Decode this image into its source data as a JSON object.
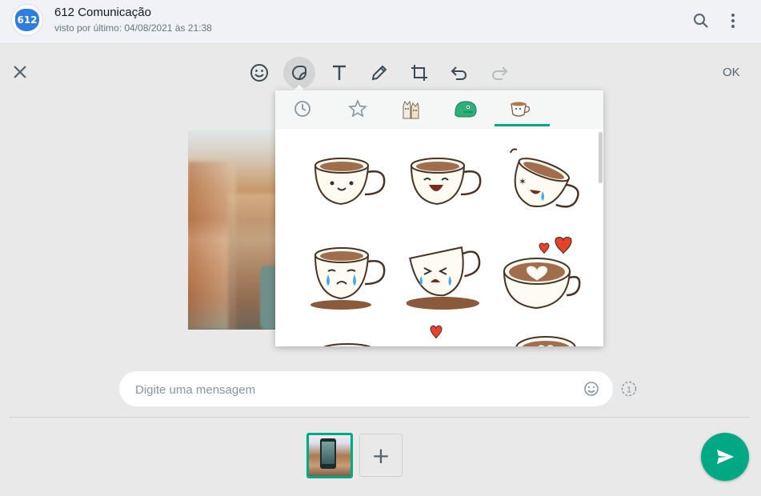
{
  "header": {
    "avatar_text": "612",
    "contact_name": "612 Comunicação",
    "status": "visto por último: 04/08/2021 às 21:38"
  },
  "editor": {
    "ok_label": "OK",
    "tools": [
      "emoji-icon",
      "sticker-icon",
      "text-icon",
      "pencil-icon",
      "crop-icon",
      "undo-icon",
      "redo-icon"
    ],
    "active_tool": "sticker-icon"
  },
  "sticker_panel": {
    "tabs": [
      "clock-icon",
      "star-icon",
      "cats-pack-icon",
      "dino-pack-icon",
      "coffee-pack-icon"
    ],
    "active_tab": "coffee-pack-icon"
  },
  "composer": {
    "placeholder": "Digite uma mensagem",
    "view_once_label": "1"
  },
  "colors": {
    "accent": "#00a884",
    "avatar": "#2f7de1",
    "coffee": "#8b5a3c",
    "heart": "#e8412c"
  }
}
